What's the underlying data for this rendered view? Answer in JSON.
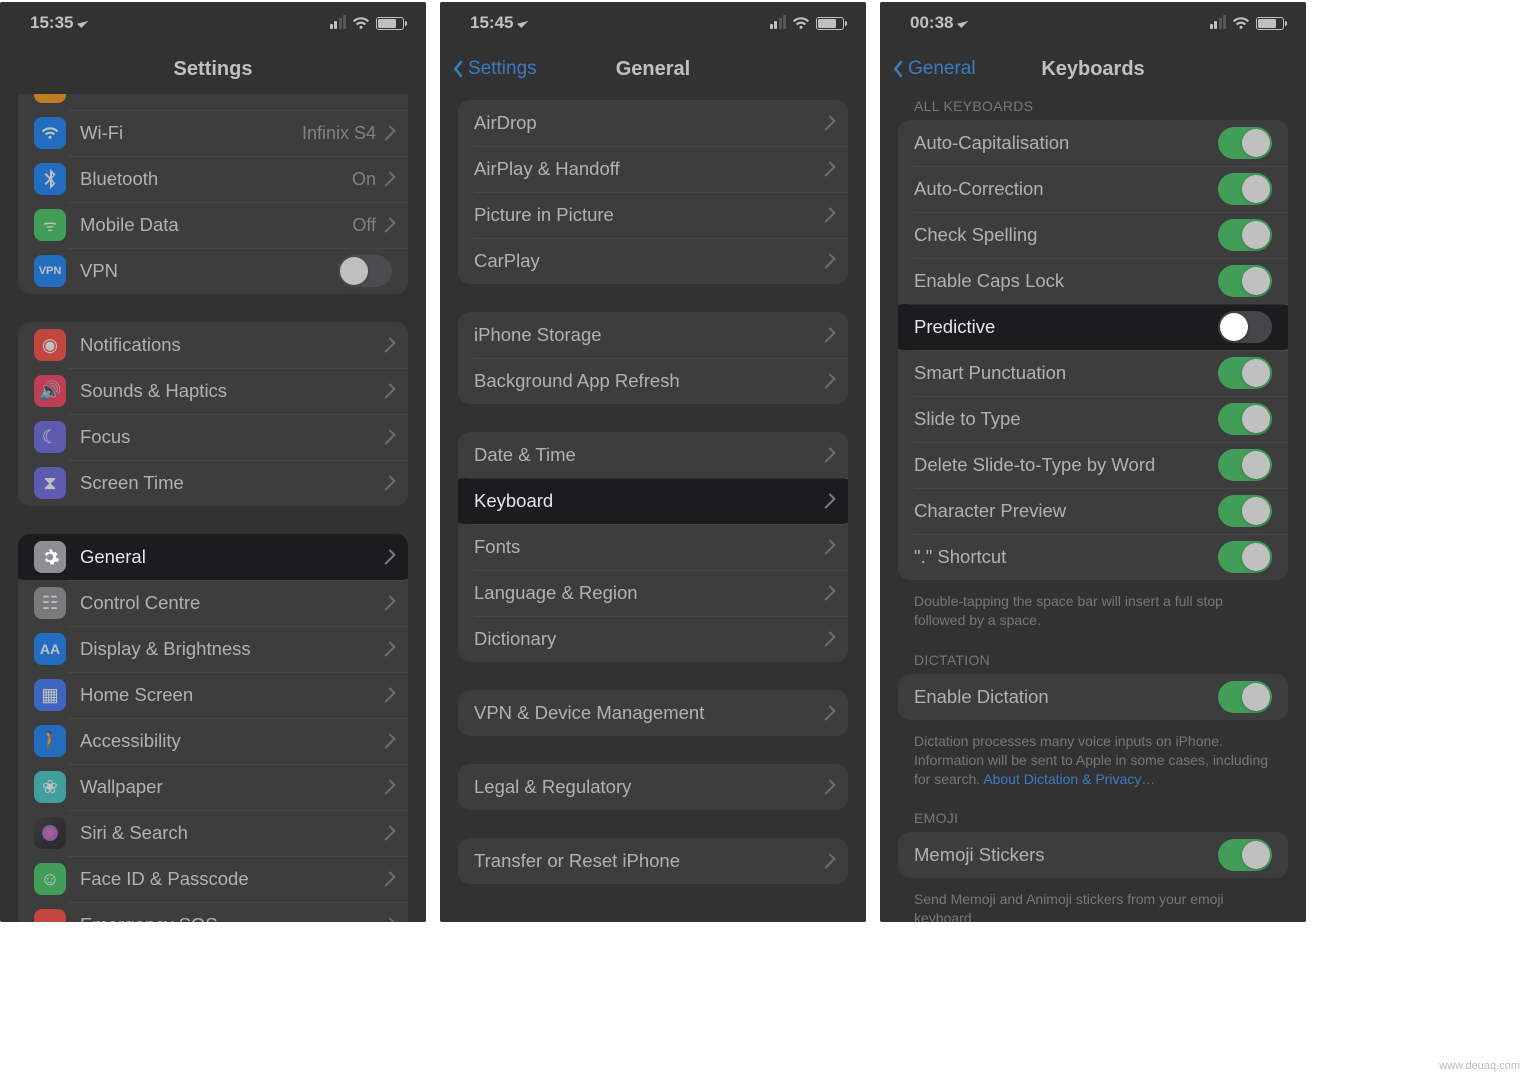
{
  "watermark": "www.deuaq.com",
  "screen1": {
    "time": "15:35",
    "title": "Settings",
    "network_group": {
      "wifi": {
        "label": "Wi-Fi",
        "value": "Infinix S4",
        "icon_color": "#007aff"
      },
      "bluetooth": {
        "label": "Bluetooth",
        "value": "On",
        "icon_color": "#007aff"
      },
      "mobile_data": {
        "label": "Mobile Data",
        "value": "Off",
        "icon_color": "#34c759"
      },
      "vpn": {
        "label": "VPN",
        "on": false,
        "icon_color": "#2e8fff"
      }
    },
    "notifications_group": {
      "notifications": {
        "label": "Notifications",
        "icon_color": "#ff3b30"
      },
      "sounds": {
        "label": "Sounds & Haptics",
        "icon_color": "#ff2d55"
      },
      "focus": {
        "label": "Focus",
        "icon_color": "#5e5ce6"
      },
      "screen_time": {
        "label": "Screen Time",
        "icon_color": "#5e5ce6"
      }
    },
    "general_group": {
      "general": {
        "label": "General",
        "icon_color": "#8e8e93"
      },
      "control_centre": {
        "label": "Control Centre",
        "icon_color": "#8e8e93"
      },
      "display": {
        "label": "Display & Brightness",
        "icon_color": "#007aff"
      },
      "home_screen": {
        "label": "Home Screen",
        "icon_color": "#2e6fff"
      },
      "accessibility": {
        "label": "Accessibility",
        "icon_color": "#007aff"
      },
      "wallpaper": {
        "label": "Wallpaper",
        "icon_color": "#34c7c7"
      },
      "siri": {
        "label": "Siri & Search",
        "icon_color": "#222"
      },
      "faceid": {
        "label": "Face ID & Passcode",
        "icon_color": "#34c759"
      },
      "emergency": {
        "label": "Emergency SOS",
        "icon_color": "#ff3b30"
      }
    }
  },
  "screen2": {
    "time": "15:45",
    "back_label": "Settings",
    "title": "General",
    "group1": {
      "airdrop": "AirDrop",
      "airplay": "AirPlay & Handoff",
      "pip": "Picture in Picture",
      "carplay": "CarPlay"
    },
    "group2": {
      "storage": "iPhone Storage",
      "background": "Background App Refresh"
    },
    "group3": {
      "date": "Date & Time",
      "keyboard": "Keyboard",
      "fonts": "Fonts",
      "language": "Language & Region",
      "dictionary": "Dictionary"
    },
    "group4": {
      "vpn_device": "VPN & Device Management"
    },
    "group5": {
      "legal": "Legal & Regulatory"
    },
    "group6": {
      "transfer": "Transfer or Reset iPhone"
    }
  },
  "screen3": {
    "time": "00:38",
    "back_label": "General",
    "title": "Keyboards",
    "section_all_keyboards": "ALL KEYBOARDS",
    "toggles": {
      "auto_cap": {
        "label": "Auto-Capitalisation",
        "on": true
      },
      "auto_correct": {
        "label": "Auto-Correction",
        "on": true
      },
      "check_spelling": {
        "label": "Check Spelling",
        "on": true
      },
      "caps_lock": {
        "label": "Enable Caps Lock",
        "on": true
      },
      "predictive": {
        "label": "Predictive",
        "on": false
      },
      "smart_punct": {
        "label": "Smart Punctuation",
        "on": true
      },
      "slide": {
        "label": "Slide to Type",
        "on": true
      },
      "delete_slide": {
        "label": "Delete Slide-to-Type by Word",
        "on": true
      },
      "char_preview": {
        "label": "Character Preview",
        "on": true
      },
      "shortcut": {
        "label": "\".\" Shortcut",
        "on": true
      }
    },
    "footer_shortcut": "Double-tapping the space bar will insert a full stop followed by a space.",
    "section_dictation": "DICTATION",
    "dictation": {
      "label": "Enable Dictation",
      "on": true
    },
    "footer_dictation": "Dictation processes many voice inputs on iPhone. Information will be sent to Apple in some cases, including for search. ",
    "dictation_link": "About Dictation & Privacy…",
    "section_emoji": "EMOJI",
    "memoji": {
      "label": "Memoji Stickers",
      "on": true
    },
    "footer_memoji": "Send Memoji and Animoji stickers from your emoji keyboard."
  }
}
